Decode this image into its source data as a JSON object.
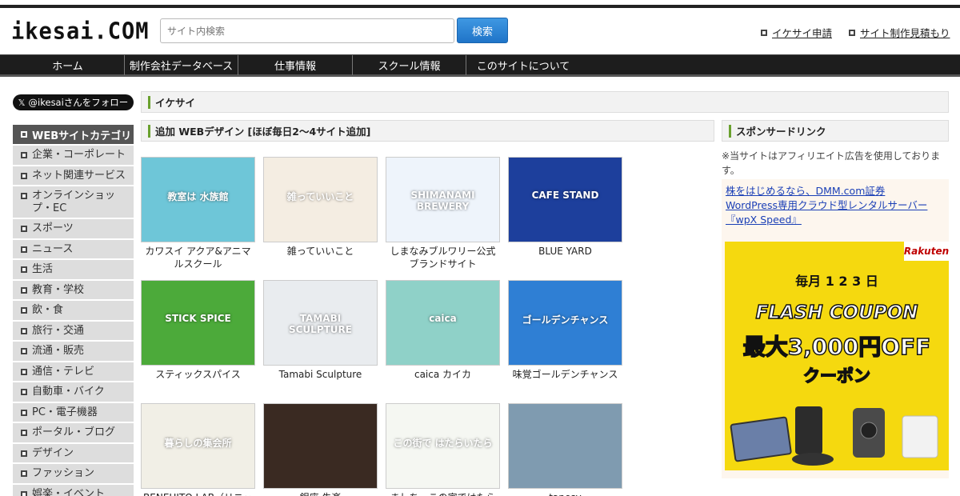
{
  "header": {
    "logo": "ikesai.COM",
    "search_placeholder": "サイト内検索",
    "search_button": "検索",
    "links": [
      "イケサイ申請",
      "サイト制作見積もり"
    ]
  },
  "nav": [
    "ホーム",
    "制作会社データベース",
    "仕事情報",
    "スクール情報",
    "このサイトについて"
  ],
  "sidebar": {
    "follow_label": "@ikesaiさんをフォロー",
    "category_heading": "WEBサイトカテゴリ",
    "categories": [
      "企業・コーポレート",
      "ネット関連サービス",
      "オンラインショップ・EC",
      "スポーツ",
      "ニュース",
      "生活",
      "教育・学校",
      "飲・食",
      "旅行・交通",
      "流通・販売",
      "通信・テレビ",
      "自動車・バイク",
      "PC・電子機器",
      "ポータル・ブログ",
      "デザイン",
      "ファッション",
      "娯楽・イベント"
    ]
  },
  "main": {
    "breadcrumb": "イケサイ",
    "section_title": "追加 WEBデザイン [ほぼ毎日2〜4サイト追加]",
    "cards": [
      {
        "title": "カワスイ アクア&アニマルスクール",
        "bg": "#6ec6d8",
        "thumb_text": "教室は 水族館"
      },
      {
        "title": "雑っていいこと",
        "bg": "#f4ede2",
        "thumb_text": "雑っていいこと"
      },
      {
        "title": "しまなみブルワリー公式ブランドサイト",
        "bg": "#eef4fb",
        "thumb_text": "SHIMANAMI BREWERY"
      },
      {
        "title": "BLUE YARD",
        "bg": "#1d3f9c",
        "thumb_text": "CAFE STAND"
      },
      {
        "title": "スティックスパイス",
        "bg": "#4caa3a",
        "thumb_text": "STICK SPICE"
      },
      {
        "title": "Tamabi Sculpture",
        "bg": "#e9ecef",
        "thumb_text": "TAMABI SCULPTURE"
      },
      {
        "title": "caica カイカ",
        "bg": "#8fd1c8",
        "thumb_text": "caica"
      },
      {
        "title": "味覚ゴールデンチャンス",
        "bg": "#2f7fd4",
        "thumb_text": "ゴールデンチャンス"
      },
      {
        "title": "BENEHITO LAB（リニュ",
        "bg": "#f1efe6",
        "thumb_text": "暮らしの集会所"
      },
      {
        "title": "銀座 朱楽",
        "bg": "#3a2a22",
        "thumb_text": ""
      },
      {
        "title": "ましち、この家ではたら",
        "bg": "#f5f7f2",
        "thumb_text": "この街で はたらいたら"
      },
      {
        "title": "tanesy",
        "bg": "#7f9bb0",
        "thumb_text": ""
      }
    ]
  },
  "right": {
    "heading": "スポンサードリンク",
    "note": "※当サイトはアフィリエイト広告を使用しております。",
    "ad_links": [
      "株をはじめるなら、DMM.com証券",
      "WordPress専用クラウド型レンタルサーバー『wpX Speed』"
    ],
    "banner": {
      "brand": "Rakuten",
      "monthly": "毎月 1 2 3 日",
      "flash": "FLASH COUPON",
      "max": "最大3,000円OFF",
      "coupon": "クーポン"
    }
  },
  "colors": {
    "accent_green": "#6aa12e",
    "nav_bg": "#1d1d1d",
    "search_blue": "#1f74c8",
    "banner_yellow": "#f5d90f"
  }
}
